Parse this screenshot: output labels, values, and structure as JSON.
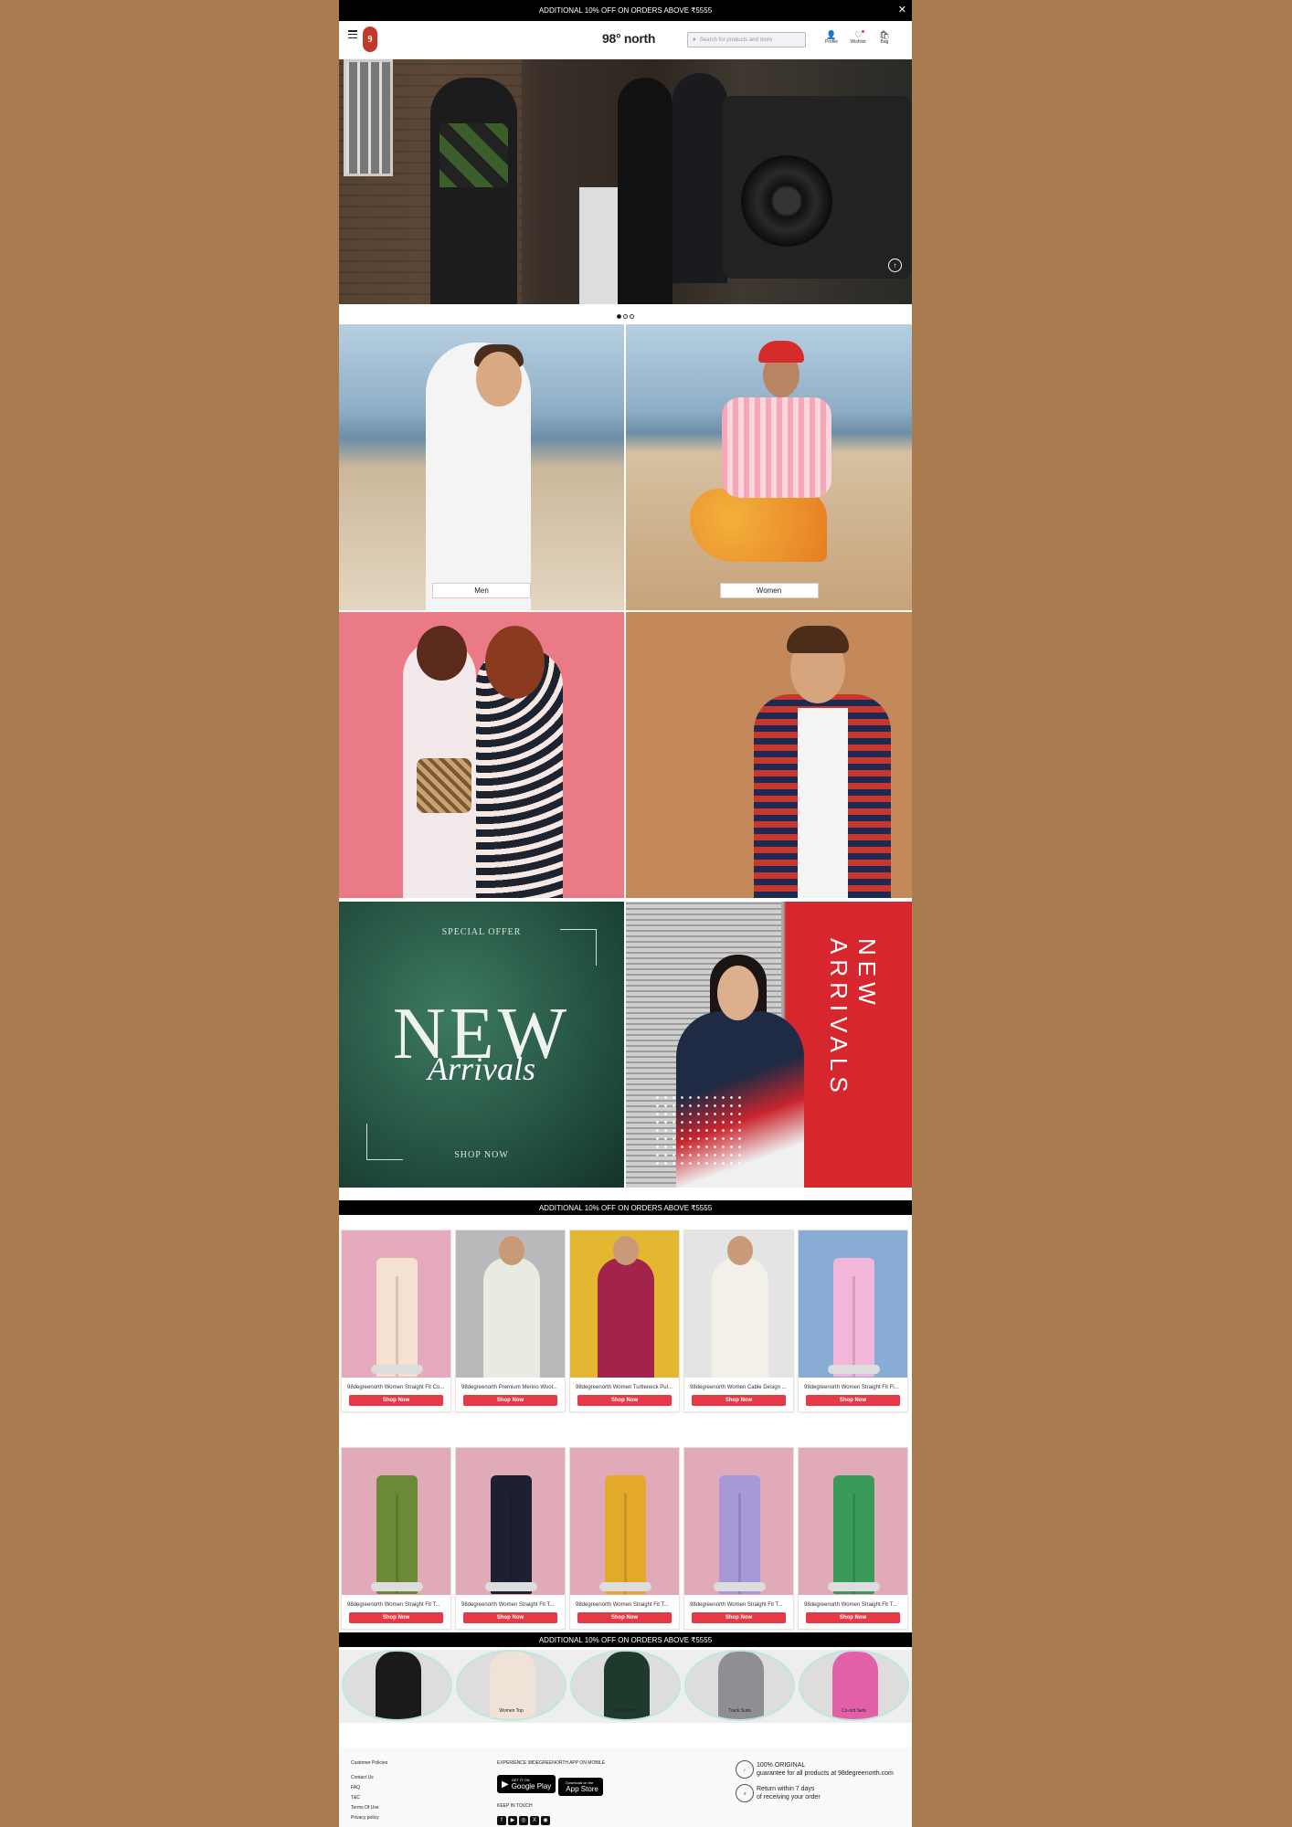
{
  "promo_top": {
    "text": "ADDITIONAL 10% OFF ON ORDERS ABOVE ₹5555",
    "close_icon": "✕"
  },
  "header": {
    "brand": "98° north",
    "badge": "9",
    "search_placeholder": "Search for products and more",
    "icons": [
      {
        "name": "profile-icon",
        "glyph": "👤",
        "label": "Profile"
      },
      {
        "name": "wishlist-icon",
        "glyph": "♡",
        "label": "Wishlist"
      },
      {
        "name": "bag-icon",
        "glyph": "🛍",
        "label": "Bag"
      }
    ]
  },
  "hero": {
    "scroll_up_icon": "↑",
    "slides": 3,
    "active_slide": 1
  },
  "categories": {
    "men": "Men",
    "women": "Women"
  },
  "banners": {
    "special_offer": "SPECIAL OFFER",
    "new": "NEW",
    "arrivals": "Arrivals",
    "shop_now": "SHOP NOW",
    "new_arrivals_vertical": "NEW ARRIVALS"
  },
  "promo_mid_1": "ADDITIONAL 10% OFF ON ORDERS ABOVE ₹5555",
  "promo_mid_2": "ADDITIONAL 10% OFF ON ORDERS ABOVE ₹5555",
  "products_row1": [
    {
      "name": "98degreenorth Women Straight Fit Co...",
      "cta": "Shop Now",
      "bg": "#e6a9bd",
      "color": "#f4e1cf",
      "kind": "pants"
    },
    {
      "name": "98degreenorth Premium Merino Wool...",
      "cta": "Shop Now",
      "bg": "#b9b9bc",
      "color": "#e8ebe2",
      "kind": "top"
    },
    {
      "name": "98degreenorth Women Turtleneck Pul...",
      "cta": "Shop Now",
      "bg": "#e3b72f",
      "color": "#a3244b",
      "kind": "top"
    },
    {
      "name": "98degreenorth Women Cable Design ...",
      "cta": "Shop Now",
      "bg": "#e4e4e4",
      "color": "#f3f0ea",
      "kind": "top"
    },
    {
      "name": "98degreenorth Women Straight Fit Fl...",
      "cta": "Shop Now",
      "bg": "#88acd3",
      "color": "#f2b6da",
      "kind": "pants"
    }
  ],
  "products_row2": [
    {
      "name": "98degreenorth Women Straight Fit T...",
      "cta": "Shop Now",
      "bg": "#e1aab9",
      "color": "#6c8a35",
      "kind": "pants"
    },
    {
      "name": "98degreenorth Women Straight Fit T...",
      "cta": "Shop Now",
      "bg": "#e1aab9",
      "color": "#1d2033",
      "kind": "pants"
    },
    {
      "name": "98degreenorth Women Straight Fit T...",
      "cta": "Shop Now",
      "bg": "#e1aab9",
      "color": "#e4a92b",
      "kind": "pants"
    },
    {
      "name": "98degreenorth Women Straight Fit T...",
      "cta": "Shop Now",
      "bg": "#e1aab9",
      "color": "#a798d8",
      "kind": "pants"
    },
    {
      "name": "98degreenorth Women Straight Fit T...",
      "cta": "Shop Now",
      "bg": "#e1aab9",
      "color": "#3a9a5c",
      "kind": "pants"
    }
  ],
  "category_circles": [
    {
      "label": "Women Bottom",
      "color": "#1a1a1a"
    },
    {
      "label": "Women Top",
      "color": "#efe3d8"
    },
    {
      "label": "Men Bottom",
      "color": "#1e3a2c"
    },
    {
      "label": "Track Suits",
      "color": "#8d8f93"
    },
    {
      "label": "Co-ord Sets",
      "color": "#e260a8"
    }
  ],
  "footer": {
    "policies_heading": "Customer Policies",
    "policies": [
      "Contact Us",
      "FAQ",
      "T&C",
      "Terms Of Use",
      "Privacy policy"
    ],
    "app_heading": "EXPERIENCE 98DEGREENORTH APP ON MOBILE",
    "google_small": "GET IT ON",
    "google": "Google Play",
    "apple_small": "Download on the",
    "apple": "App Store",
    "keep_in_touch": "KEEP IN TOUCH",
    "social": [
      "f",
      "▶",
      "◎",
      "X",
      "◉"
    ],
    "original_title": "100% ORIGINAL",
    "original_text": "guarantee for all products at 98degreenorth.com",
    "return_title": "Return within 7 days",
    "return_text": "of receiving your order"
  }
}
